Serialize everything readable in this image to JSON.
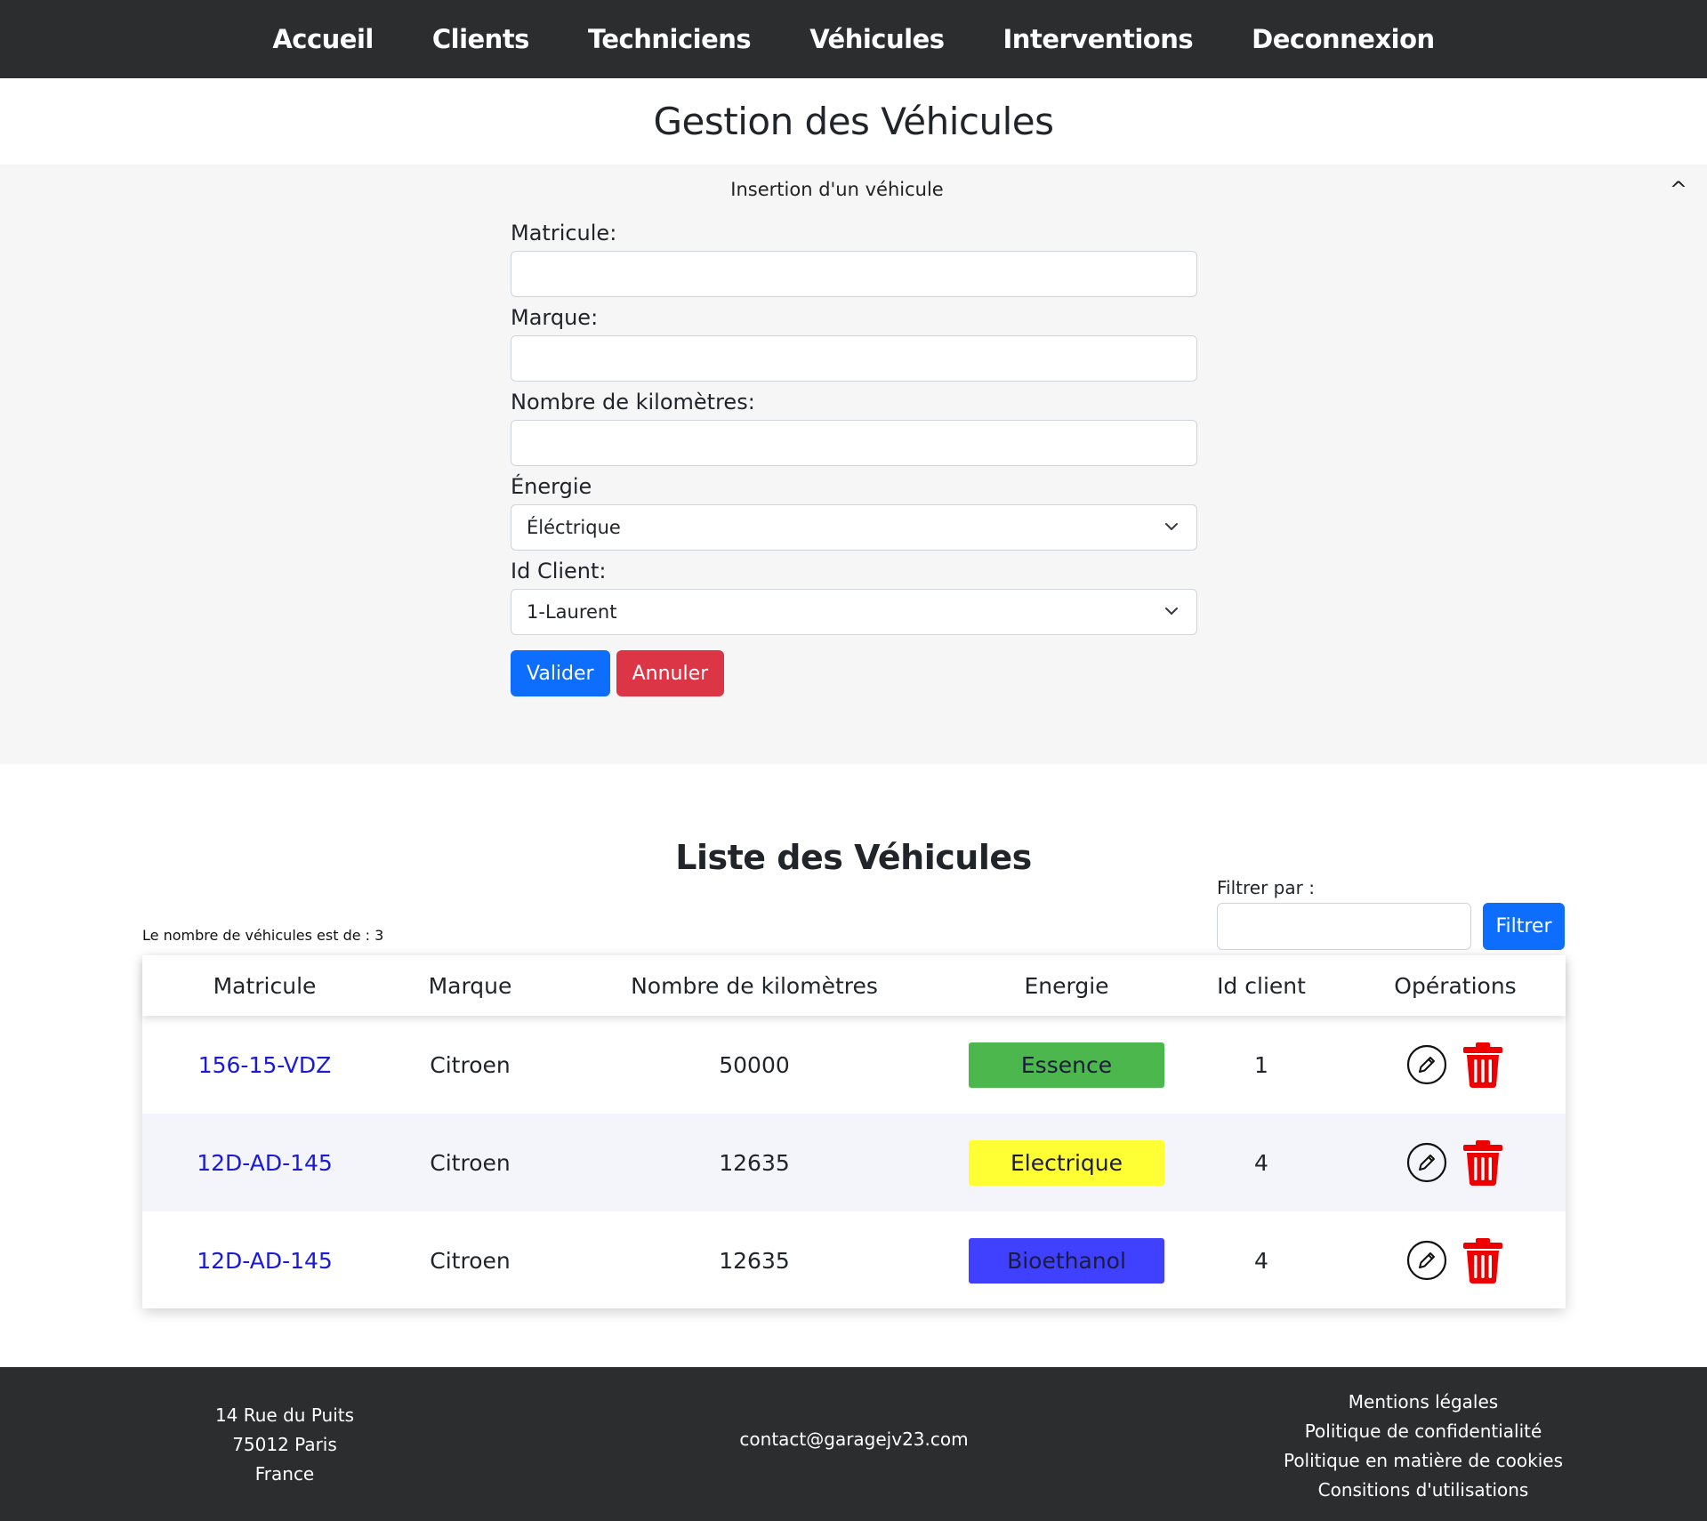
{
  "nav": [
    "Accueil",
    "Clients",
    "Techniciens",
    "Véhicules",
    "Interventions",
    "Deconnexion"
  ],
  "page_title": "Gestion des Véhicules",
  "form": {
    "caption": "Insertion d'un véhicule",
    "toggle": "^",
    "matricule_label": "Matricule:",
    "marque_label": "Marque:",
    "km_label": "Nombre de kilomètres:",
    "energie_label": "Énergie",
    "energie_value": "Éléctrique",
    "client_label": "Id Client:",
    "client_value": "1-Laurent",
    "submit": "Valider",
    "cancel": "Annuler"
  },
  "list": {
    "title": "Liste des Véhicules",
    "filter_label": "Filtrer par :",
    "filter_button": "Filtrer",
    "count_label": "Le nombre de véhicules est de :",
    "count_value": "3",
    "headers": [
      "Matricule",
      "Marque",
      "Nombre de kilomètres",
      "Energie",
      "Id client",
      "Opérations"
    ],
    "rows": [
      {
        "matricule": "156-15-VDZ",
        "marque": "Citroen",
        "km": "50000",
        "energie": "Essence",
        "energie_color": "#4cb74c",
        "client": "1"
      },
      {
        "matricule": "12D-AD-145",
        "marque": "Citroen",
        "km": "12635",
        "energie": "Electrique",
        "energie_color": "#ffff33",
        "client": "4"
      },
      {
        "matricule": "12D-AD-145",
        "marque": "Citroen",
        "km": "12635",
        "energie": "Bioethanol",
        "energie_color": "#4040ff",
        "client": "4"
      }
    ]
  },
  "footer": {
    "address": [
      "14 Rue du Puits",
      "75012 Paris",
      "France"
    ],
    "email": "contact@garagejv23.com",
    "links": [
      "Mentions légales",
      "Politique de confidentialité",
      "Politique en matière de cookies",
      "Consitions d'utilisations"
    ]
  }
}
